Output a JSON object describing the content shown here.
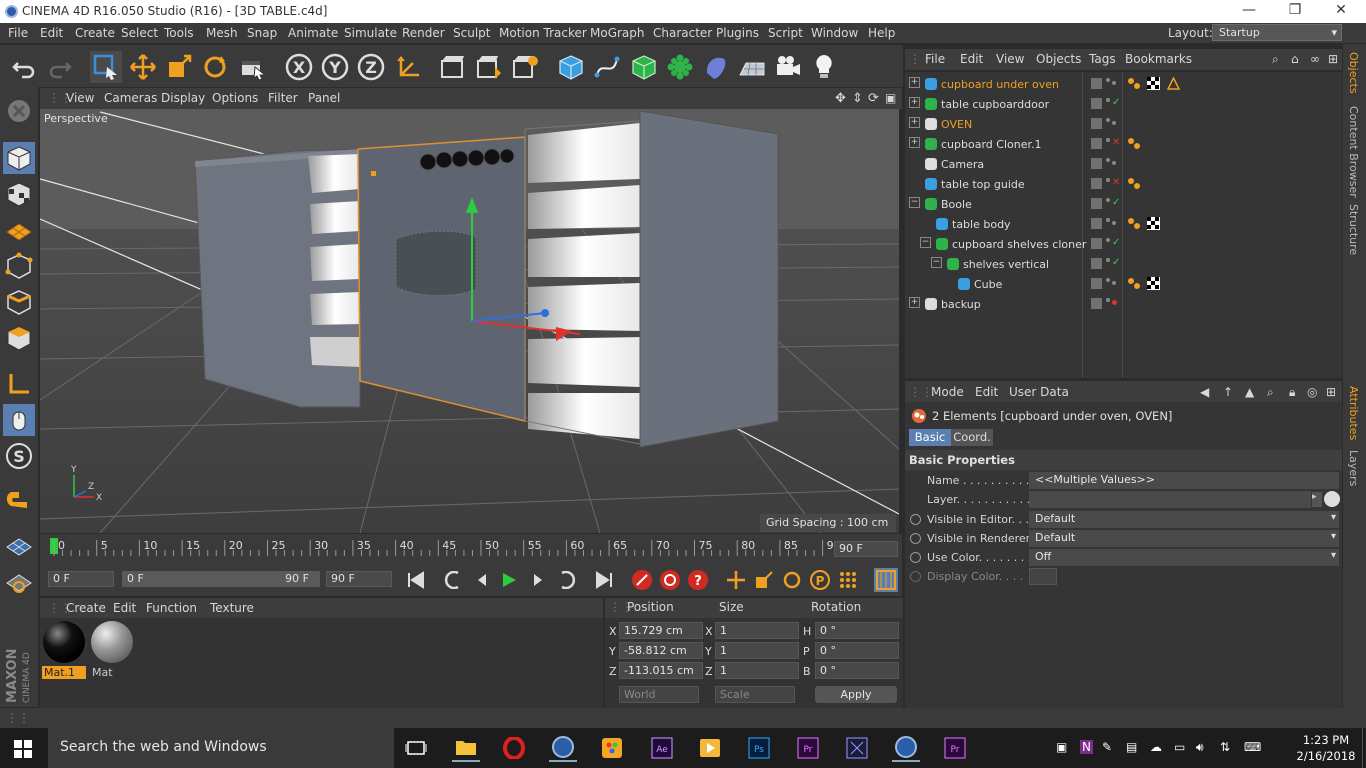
{
  "window": {
    "title": "CINEMA 4D R16.050 Studio (R16) - [3D TABLE.c4d]",
    "controls": [
      "—",
      "❐",
      "✕"
    ]
  },
  "menubar": {
    "items": [
      "File",
      "Edit",
      "Create",
      "Select",
      "Tools",
      "Mesh",
      "Snap",
      "Animate",
      "Simulate",
      "Render",
      "Sculpt",
      "Motion Tracker",
      "MoGraph",
      "Character",
      "Plugins",
      "Script",
      "Window",
      "Help"
    ],
    "layout_label": "Layout:",
    "layout_value": "Startup"
  },
  "toolbar": {
    "icons": [
      "undo-icon",
      "redo-icon",
      "live-selection-icon",
      "move-icon",
      "scale-icon",
      "rotate-icon",
      "last-tool-icon",
      "x-axis-icon",
      "y-axis-icon",
      "z-axis-icon",
      "coordinate-system-icon",
      "render-view-icon",
      "render-picture-viewer-icon",
      "edit-render-settings-icon",
      "cube-icon",
      "pen-icon",
      "subdivision-icon",
      "cloner-icon",
      "deformer-icon",
      "floor-icon",
      "camera-icon",
      "light-icon"
    ],
    "axis_letters": [
      "X",
      "Y",
      "Z"
    ]
  },
  "left_toolbar": {
    "icons": [
      "make-editable-icon",
      "model-mode-icon",
      "texture-mode-icon",
      "workplane-icon",
      "points-mode-icon",
      "edges-mode-icon",
      "polygons-mode-icon",
      "axis-icon",
      "tweak-icon",
      "solo-icon",
      "snap-icon",
      "grid-snap-icon",
      "locked-workplane-icon"
    ]
  },
  "viewport": {
    "menu": [
      "View",
      "Cameras",
      "Display",
      "Options",
      "Filter",
      "Panel"
    ],
    "label": "Perspective",
    "grid_spacing": "Grid Spacing : 100 cm",
    "oven_panel": {
      "knob_count": 6
    }
  },
  "timeline": {
    "ticks": [
      "0",
      "5",
      "10",
      "15",
      "20",
      "25",
      "30",
      "35",
      "40",
      "45",
      "50",
      "55",
      "60",
      "65",
      "70",
      "75",
      "80",
      "85",
      "90"
    ],
    "current_frame": "0 F",
    "end_frame_field": "90 F",
    "start_field": "0 F",
    "range_start": "0 F",
    "range_end": "90 F",
    "range_end_field": "90 F"
  },
  "materials": {
    "menu": [
      "Create",
      "Edit",
      "Function",
      "Texture"
    ],
    "items": [
      {
        "name": "Mat.1",
        "selected": true
      },
      {
        "name": "Mat",
        "selected": false
      }
    ]
  },
  "coordinates": {
    "headers": [
      "Position",
      "Size",
      "Rotation"
    ],
    "rows": [
      {
        "axis": "X",
        "position": "15.729 cm",
        "size_axis": "X",
        "size": "1",
        "rot_axis": "H",
        "rotation": "0 °"
      },
      {
        "axis": "Y",
        "position": "-58.812 cm",
        "size_axis": "Y",
        "size": "1",
        "rot_axis": "P",
        "rotation": "0 °"
      },
      {
        "axis": "Z",
        "position": "-113.015 cm",
        "size_axis": "Z",
        "size": "1",
        "rot_axis": "B",
        "rotation": "0 °"
      }
    ],
    "mode_world": "World",
    "mode_scale": "Scale",
    "apply": "Apply"
  },
  "object_manager": {
    "menu": [
      "File",
      "Edit",
      "View",
      "Objects",
      "Tags",
      "Bookmarks"
    ],
    "objects": [
      {
        "name": "cupboard under oven",
        "indent": 0,
        "highlight": true,
        "status": "gray",
        "expand": "+"
      },
      {
        "name": "table cupboarddoor",
        "indent": 0,
        "highlight": false,
        "status": "check",
        "expand": "+"
      },
      {
        "name": "OVEN",
        "indent": 0,
        "highlight": true,
        "status": "gray",
        "expand": "+"
      },
      {
        "name": "cupboard Cloner.1",
        "indent": 0,
        "highlight": false,
        "status": "x",
        "expand": "+"
      },
      {
        "name": "Camera",
        "indent": 0,
        "highlight": false,
        "status": "gray",
        "expand": ""
      },
      {
        "name": "table top guide",
        "indent": 0,
        "highlight": false,
        "status": "x",
        "expand": ""
      },
      {
        "name": "Boole",
        "indent": 0,
        "highlight": false,
        "status": "check",
        "expand": "−"
      },
      {
        "name": "table body",
        "indent": 1,
        "highlight": false,
        "status": "gray",
        "expand": ""
      },
      {
        "name": "cupboard shelves cloner",
        "indent": 1,
        "highlight": false,
        "status": "check",
        "expand": "−"
      },
      {
        "name": "shelves vertical",
        "indent": 2,
        "highlight": false,
        "status": "check",
        "expand": "−"
      },
      {
        "name": "Cube",
        "indent": 3,
        "highlight": false,
        "status": "gray",
        "expand": ""
      },
      {
        "name": "backup",
        "indent": 0,
        "highlight": false,
        "status": "red",
        "expand": "+"
      }
    ]
  },
  "attribute_manager": {
    "menu": [
      "Mode",
      "Edit",
      "User Data"
    ],
    "selection": "2 Elements [cupboard under oven, OVEN]",
    "tabs": [
      "Basic",
      "Coord."
    ],
    "section": "Basic Properties",
    "fields": [
      {
        "label": "Name . . . . . . . . . . .",
        "value": "<<Multiple Values>>"
      },
      {
        "label": "Layer. . . . . . . . . . . .",
        "value": ""
      },
      {
        "label": "Visible in Editor. . .",
        "value": "Default"
      },
      {
        "label": "Visible in Renderer",
        "value": "Default"
      },
      {
        "label": "Use Color. . . . . . . .",
        "value": "Off"
      },
      {
        "label": "Display Color. . . .",
        "value": ""
      }
    ]
  },
  "side_tabs": [
    "Objects",
    "Content Browser",
    "Structure",
    "Attributes",
    "Layers"
  ],
  "taskbar": {
    "search_placeholder": "Search the web and Windows",
    "time": "1:23 PM",
    "date": "2/16/2018"
  },
  "colors": {
    "accent_orange": "#f0a020",
    "selected_blue": "#5a7fb0",
    "viewport_bg": "#5a5a5a"
  },
  "branding": "MAXON CINEMA 4D"
}
